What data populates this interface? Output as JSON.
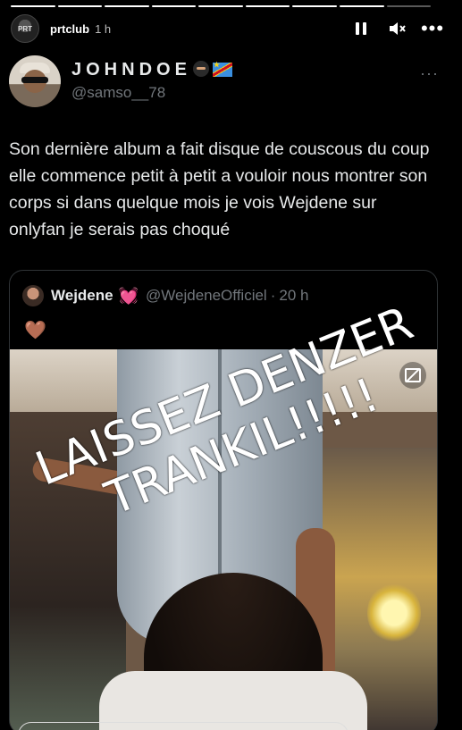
{
  "story": {
    "progress_segments": 9,
    "progress_done": 8,
    "avatar_text": "PRT",
    "username": "prtclub",
    "time": "1 h",
    "icons": {
      "pause": "pause-icon",
      "mute": "speaker-muted-icon",
      "more": "more-icon"
    }
  },
  "tweet": {
    "display_name": "JOHNDOE",
    "handle": "@samso__78",
    "more": "···",
    "text": "Son dernière album a fait disque de couscous du coup elle commence petit à petit a vouloir nous montrer son corps si dans quelque mois je vois Wejdene sur onlyfan je serais pas choqué"
  },
  "quote": {
    "name": "Wejdene",
    "heart": "💓",
    "handle": "@WejdeneOfficiel",
    "dot": "·",
    "time": "20 h",
    "emoji": "🤎",
    "overlay_line1": "LAISSEZ DENZER",
    "overlay_line2": "TRANKIL!!!!!"
  },
  "colors": {
    "accent_pink": "#ff3ec8",
    "muted": "#71767b",
    "text": "#e7e9ea"
  }
}
